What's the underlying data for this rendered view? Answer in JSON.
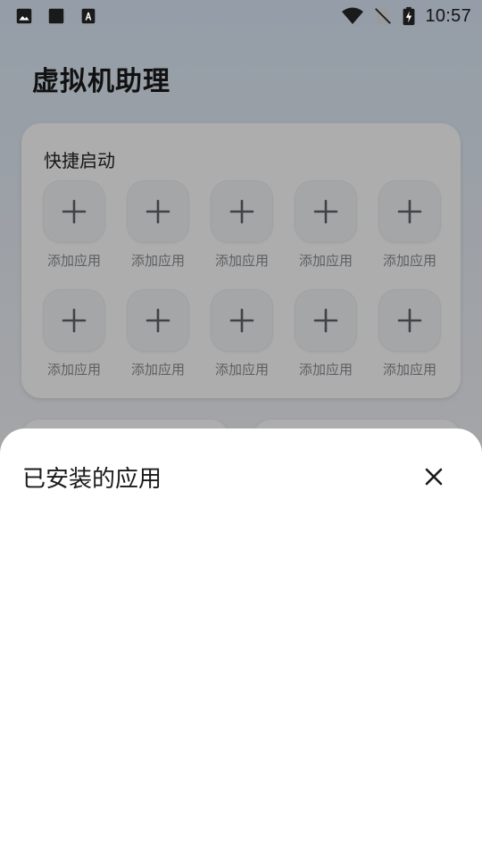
{
  "status_bar": {
    "time": "10:57",
    "left_icons": [
      "image-icon",
      "square-icon",
      "font-download-icon"
    ],
    "right_icons": [
      "wifi-icon",
      "no-sim-icon",
      "battery-charging-icon"
    ]
  },
  "app": {
    "title": "虚拟机助理"
  },
  "quick_launch": {
    "title": "快捷启动",
    "slots": [
      {
        "label": "添加应用"
      },
      {
        "label": "添加应用"
      },
      {
        "label": "添加应用"
      },
      {
        "label": "添加应用"
      },
      {
        "label": "添加应用"
      },
      {
        "label": "添加应用"
      },
      {
        "label": "添加应用"
      },
      {
        "label": "添加应用"
      },
      {
        "label": "添加应用"
      },
      {
        "label": "添加应用"
      }
    ]
  },
  "sheet": {
    "title": "已安装的应用",
    "close_icon": "close-icon"
  },
  "colors": {
    "scrim": "#000000",
    "sheet_bg": "#ffffff",
    "plus_icon": "#5f6368",
    "slot_label": "#8a8d92"
  }
}
